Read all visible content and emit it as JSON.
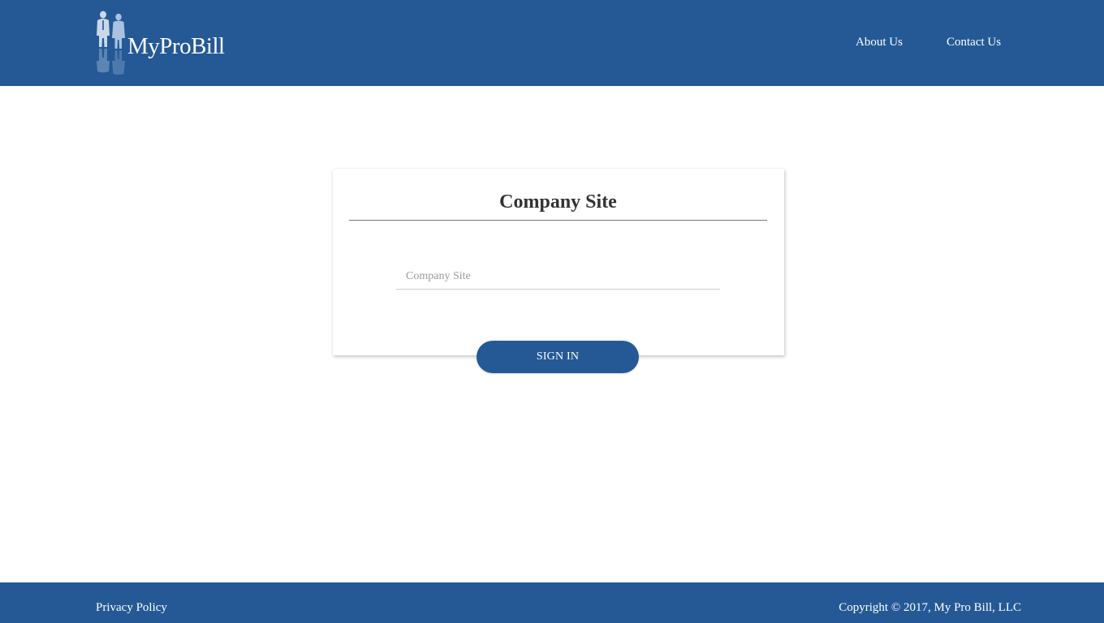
{
  "header": {
    "logo_text": "MyProBill",
    "nav": {
      "about_label": "About Us",
      "contact_label": "Contact Us"
    }
  },
  "login_card": {
    "title": "Company Site",
    "company_site_input": {
      "value": "",
      "placeholder": "Company Site"
    },
    "signin_label": "SIGN IN"
  },
  "footer": {
    "privacy_label": "Privacy Policy",
    "copyright": "Copyright © 2017, My Pro Bill, LLC"
  },
  "colors": {
    "brand_blue": "#245996",
    "white": "#ffffff",
    "text_dark": "#333333",
    "placeholder_gray": "#9a9a9a"
  },
  "icons": {
    "logo_figures": "business-people-silhouette-icon"
  }
}
